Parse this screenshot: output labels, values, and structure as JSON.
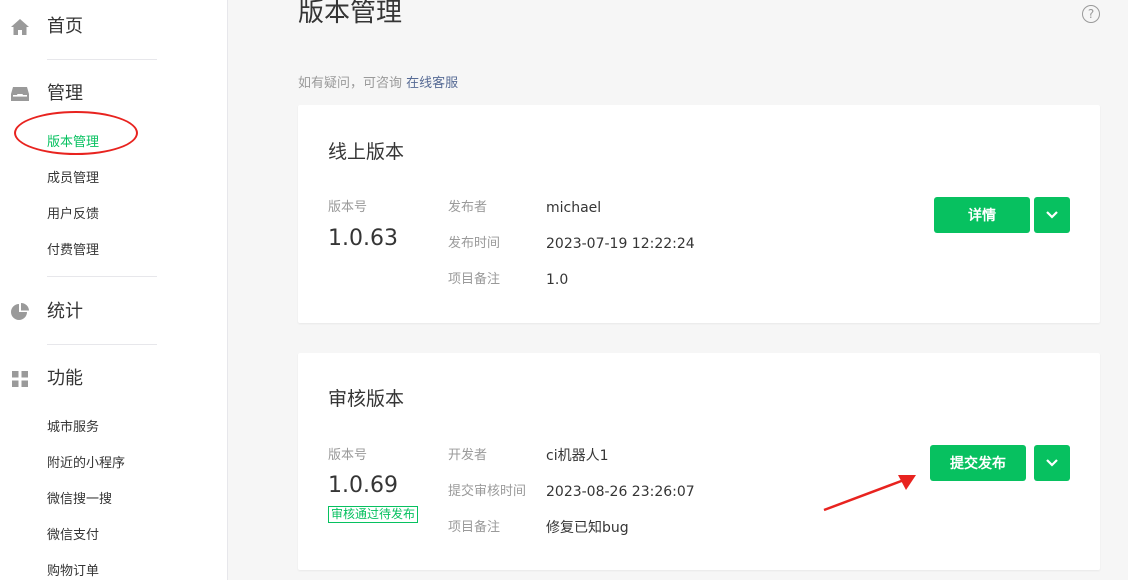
{
  "sidebar": {
    "home": {
      "label": "首页",
      "icon": "home-icon"
    },
    "manage": {
      "label": "管理",
      "icon": "inbox-icon",
      "items": [
        "版本管理",
        "成员管理",
        "用户反馈",
        "付费管理"
      ]
    },
    "stats": {
      "label": "统计",
      "icon": "pie-chart-icon"
    },
    "features": {
      "label": "功能",
      "icon": "grid-icon",
      "items": [
        "城市服务",
        "附近的小程序",
        "微信搜一搜",
        "微信支付",
        "购物订单"
      ]
    }
  },
  "main": {
    "title": "版本管理",
    "hint_text": "如有疑问，可咨询",
    "hint_link": "在线客服",
    "online": {
      "title": "线上版本",
      "version_label": "版本号",
      "version": "1.0.63",
      "fields": [
        {
          "label": "发布者",
          "value": "michael"
        },
        {
          "label": "发布时间",
          "value": "2023-07-19 12:22:24"
        },
        {
          "label": "项目备注",
          "value": "1.0"
        }
      ],
      "button": "详情"
    },
    "review": {
      "title": "审核版本",
      "version_label": "版本号",
      "version": "1.0.69",
      "status": "审核通过待发布",
      "fields": [
        {
          "label": "开发者",
          "value": "ci机器人1"
        },
        {
          "label": "提交审核时间",
          "value": "2023-08-26 23:26:07"
        },
        {
          "label": "项目备注",
          "value": "修复已知bug"
        }
      ],
      "button": "提交发布"
    }
  },
  "colors": {
    "accent": "#07c160",
    "annotation": "#e8231f",
    "link": "#576b95"
  }
}
